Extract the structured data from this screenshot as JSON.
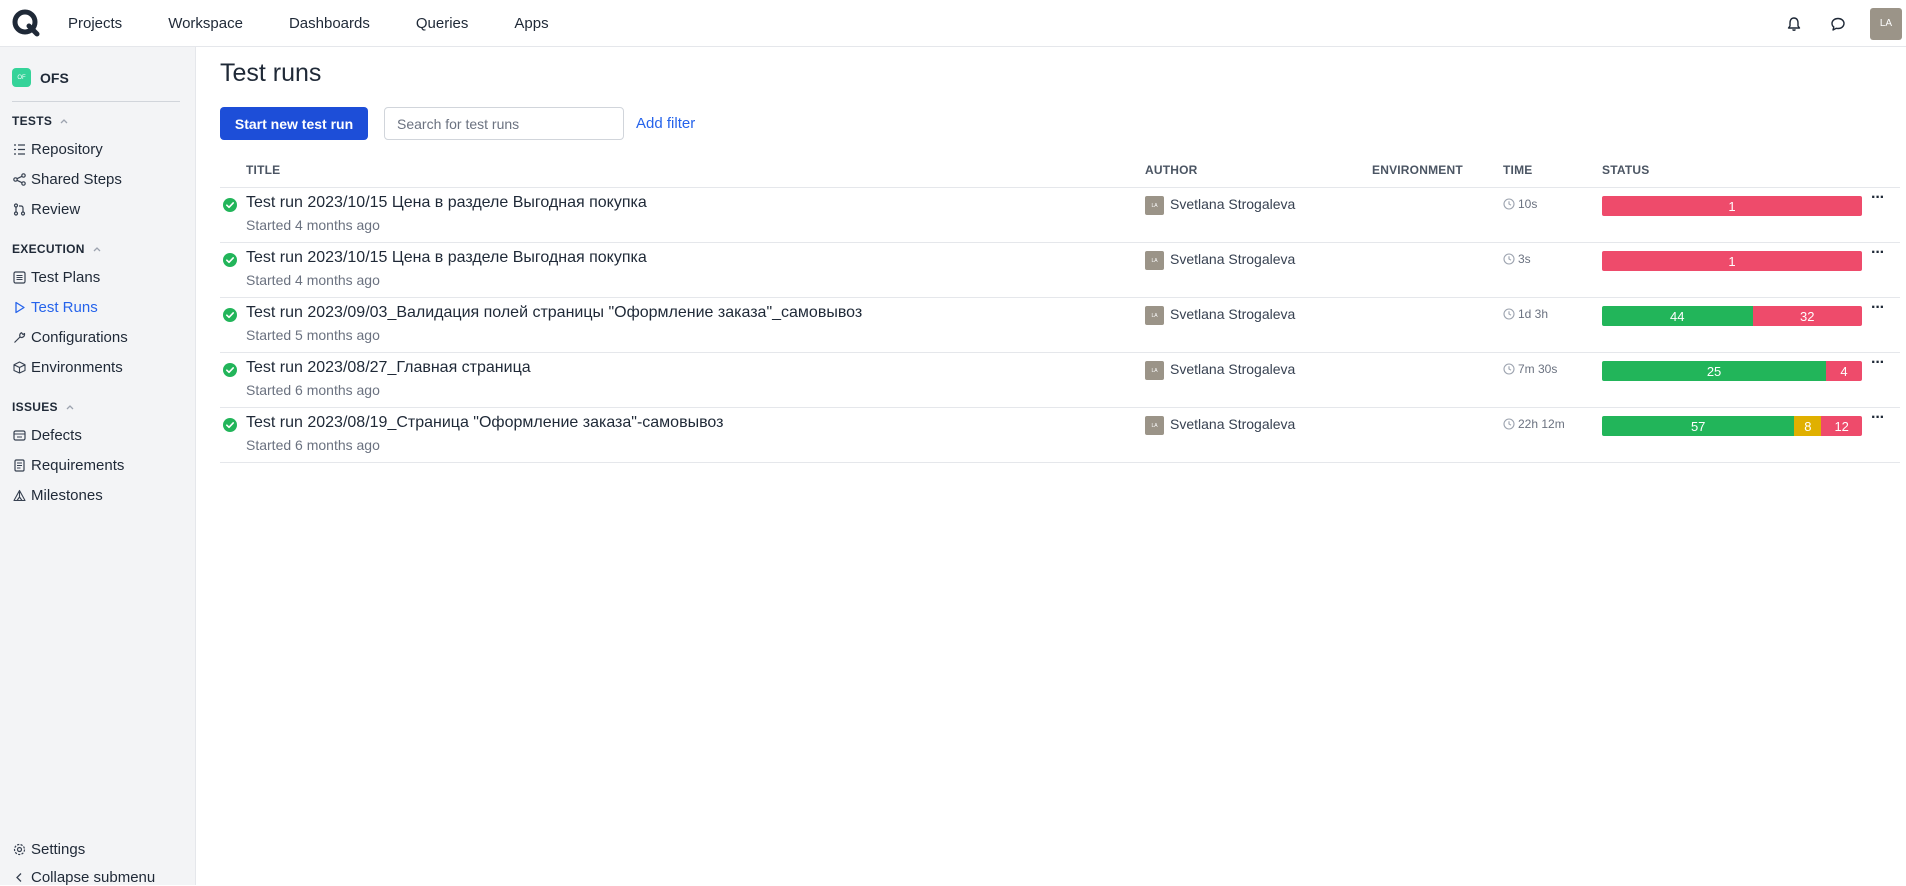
{
  "header": {
    "nav": [
      "Projects",
      "Workspace",
      "Dashboards",
      "Queries",
      "Apps"
    ],
    "avatar_initials": "LA"
  },
  "sidebar": {
    "project_badge": "OF",
    "project_name": "OFS",
    "sections": [
      {
        "title": "TESTS",
        "items": [
          "Repository",
          "Shared Steps",
          "Review"
        ]
      },
      {
        "title": "EXECUTION",
        "items": [
          "Test Plans",
          "Test Runs",
          "Configurations",
          "Environments"
        ]
      },
      {
        "title": "ISSUES",
        "items": [
          "Defects",
          "Requirements",
          "Milestones"
        ]
      }
    ],
    "settings": "Settings",
    "collapse": "Collapse submenu"
  },
  "main": {
    "title": "Test runs",
    "start_button": "Start new test run",
    "search_placeholder": "Search for test runs",
    "add_filter": "Add filter",
    "columns": [
      "TITLE",
      "AUTHOR",
      "ENVIRONMENT",
      "TIME",
      "STATUS"
    ],
    "rows": [
      {
        "title": "Test run 2023/10/15 Цена в разделе Выгодная покупка",
        "started": "Started 4 months ago",
        "author_initials": "LA",
        "author": "Svetlana Strogaleva",
        "time": "10s",
        "status": [
          {
            "kind": "fail",
            "value": "1",
            "fraction": 1.0
          }
        ]
      },
      {
        "title": "Test run 2023/10/15 Цена в разделе Выгодная покупка",
        "started": "Started 4 months ago",
        "author_initials": "LA",
        "author": "Svetlana Strogaleva",
        "time": "3s",
        "status": [
          {
            "kind": "fail",
            "value": "1",
            "fraction": 1.0
          }
        ]
      },
      {
        "title": "Test run 2023/09/03_Валидация полей страницы \"Оформление заказа\"_самовывоз",
        "started": "Started 5 months ago",
        "author_initials": "LA",
        "author": "Svetlana Strogaleva",
        "time": "1d 3h",
        "status": [
          {
            "kind": "pass",
            "value": "44",
            "fraction": 0.579
          },
          {
            "kind": "fail",
            "value": "32",
            "fraction": 0.421
          }
        ]
      },
      {
        "title": "Test run 2023/08/27_Главная страница",
        "started": "Started 6 months ago",
        "author_initials": "LA",
        "author": "Svetlana Strogaleva",
        "time": "7m 30s",
        "status": [
          {
            "kind": "pass",
            "value": "25",
            "fraction": 0.862
          },
          {
            "kind": "fail",
            "value": "4",
            "fraction": 0.138
          }
        ]
      },
      {
        "title": "Test run 2023/08/19_Страница \"Оформление заказа\"-самовывоз",
        "started": "Started 6 months ago",
        "author_initials": "LA",
        "author": "Svetlana Strogaleva",
        "time": "22h 12m",
        "status": [
          {
            "kind": "pass",
            "value": "57",
            "fraction": 0.74
          },
          {
            "kind": "warn",
            "value": "8",
            "fraction": 0.104
          },
          {
            "kind": "fail",
            "value": "12",
            "fraction": 0.156
          }
        ]
      }
    ]
  },
  "colors": {
    "accent": "#1d4ed8",
    "pass": "#22b55a",
    "fail": "#ee4b6b",
    "warn": "#e0b000"
  }
}
